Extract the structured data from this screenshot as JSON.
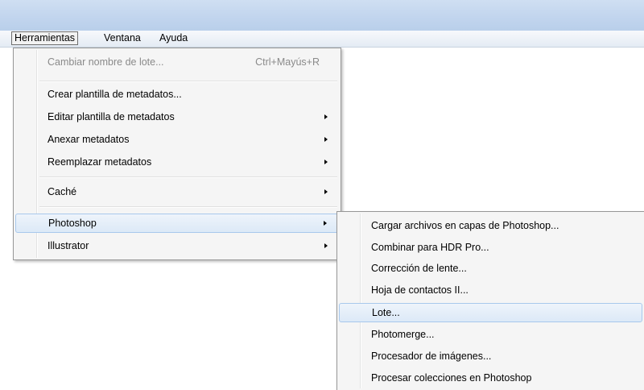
{
  "menubar": {
    "items": [
      "Herramientas",
      "Ventana",
      "Ayuda"
    ]
  },
  "tools_menu": {
    "items": [
      {
        "label": "Cambiar nombre de lote...",
        "shortcut": "Ctrl+Mayús+R",
        "disabled": true
      },
      {
        "label": "Crear plantilla de metadatos..."
      },
      {
        "label": "Editar plantilla de metadatos",
        "submenu": true
      },
      {
        "label": "Anexar metadatos",
        "submenu": true
      },
      {
        "label": "Reemplazar metadatos",
        "submenu": true
      },
      {
        "label": "Caché",
        "submenu": true
      },
      {
        "label": "Photoshop",
        "submenu": true,
        "highlighted": true
      },
      {
        "label": "Illustrator",
        "submenu": true
      }
    ]
  },
  "photoshop_submenu": {
    "items": [
      {
        "label": "Cargar archivos en capas de Photoshop..."
      },
      {
        "label": "Combinar para HDR Pro..."
      },
      {
        "label": "Corrección de lente..."
      },
      {
        "label": "Hoja de contactos II..."
      },
      {
        "label": "Lote...",
        "highlighted": true
      },
      {
        "label": "Photomerge..."
      },
      {
        "label": "Procesador de imágenes..."
      },
      {
        "label": "Procesar colecciones en Photoshop"
      }
    ]
  },
  "colors": {
    "highlight_border": "#a8c8ec",
    "highlight_fill": "#dce9f7",
    "titlebar": "#c2d5ee"
  }
}
